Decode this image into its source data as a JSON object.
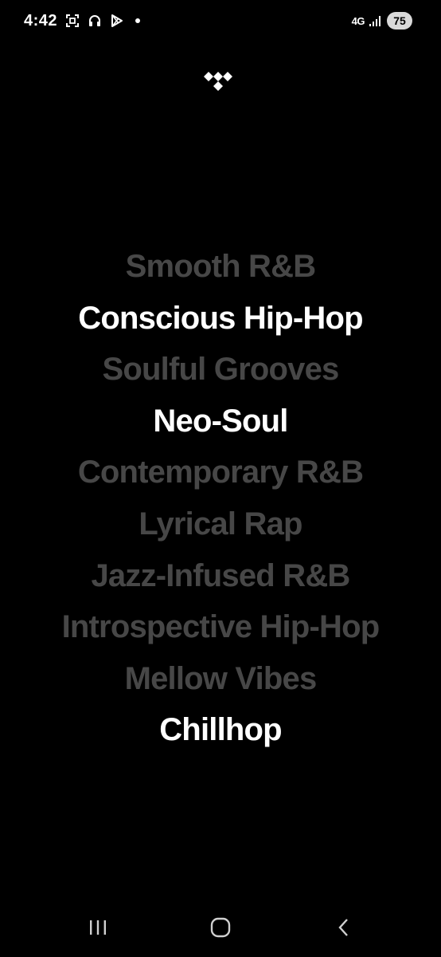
{
  "status_bar": {
    "time": "4:42",
    "network": "4G",
    "battery": "75"
  },
  "genres": [
    {
      "label": "Smooth R&B",
      "highlighted": false
    },
    {
      "label": "Conscious Hip-Hop",
      "highlighted": true
    },
    {
      "label": "Soulful Grooves",
      "highlighted": false
    },
    {
      "label": "Neo-Soul",
      "highlighted": true
    },
    {
      "label": "Contemporary R&B",
      "highlighted": false
    },
    {
      "label": "Lyrical Rap",
      "highlighted": false
    },
    {
      "label": "Jazz-Infused R&B",
      "highlighted": false
    },
    {
      "label": "Introspective Hip-Hop",
      "highlighted": false
    },
    {
      "label": "Mellow Vibes",
      "highlighted": false
    },
    {
      "label": "Chillhop",
      "highlighted": true
    }
  ],
  "colors": {
    "background": "#000000",
    "highlighted_text": "#ffffff",
    "dimmed_text": "#474747"
  },
  "icons": {
    "logo": "tidal-logo-icon",
    "nav_recents": "recent-apps-icon",
    "nav_home": "home-icon",
    "nav_back": "back-icon"
  }
}
